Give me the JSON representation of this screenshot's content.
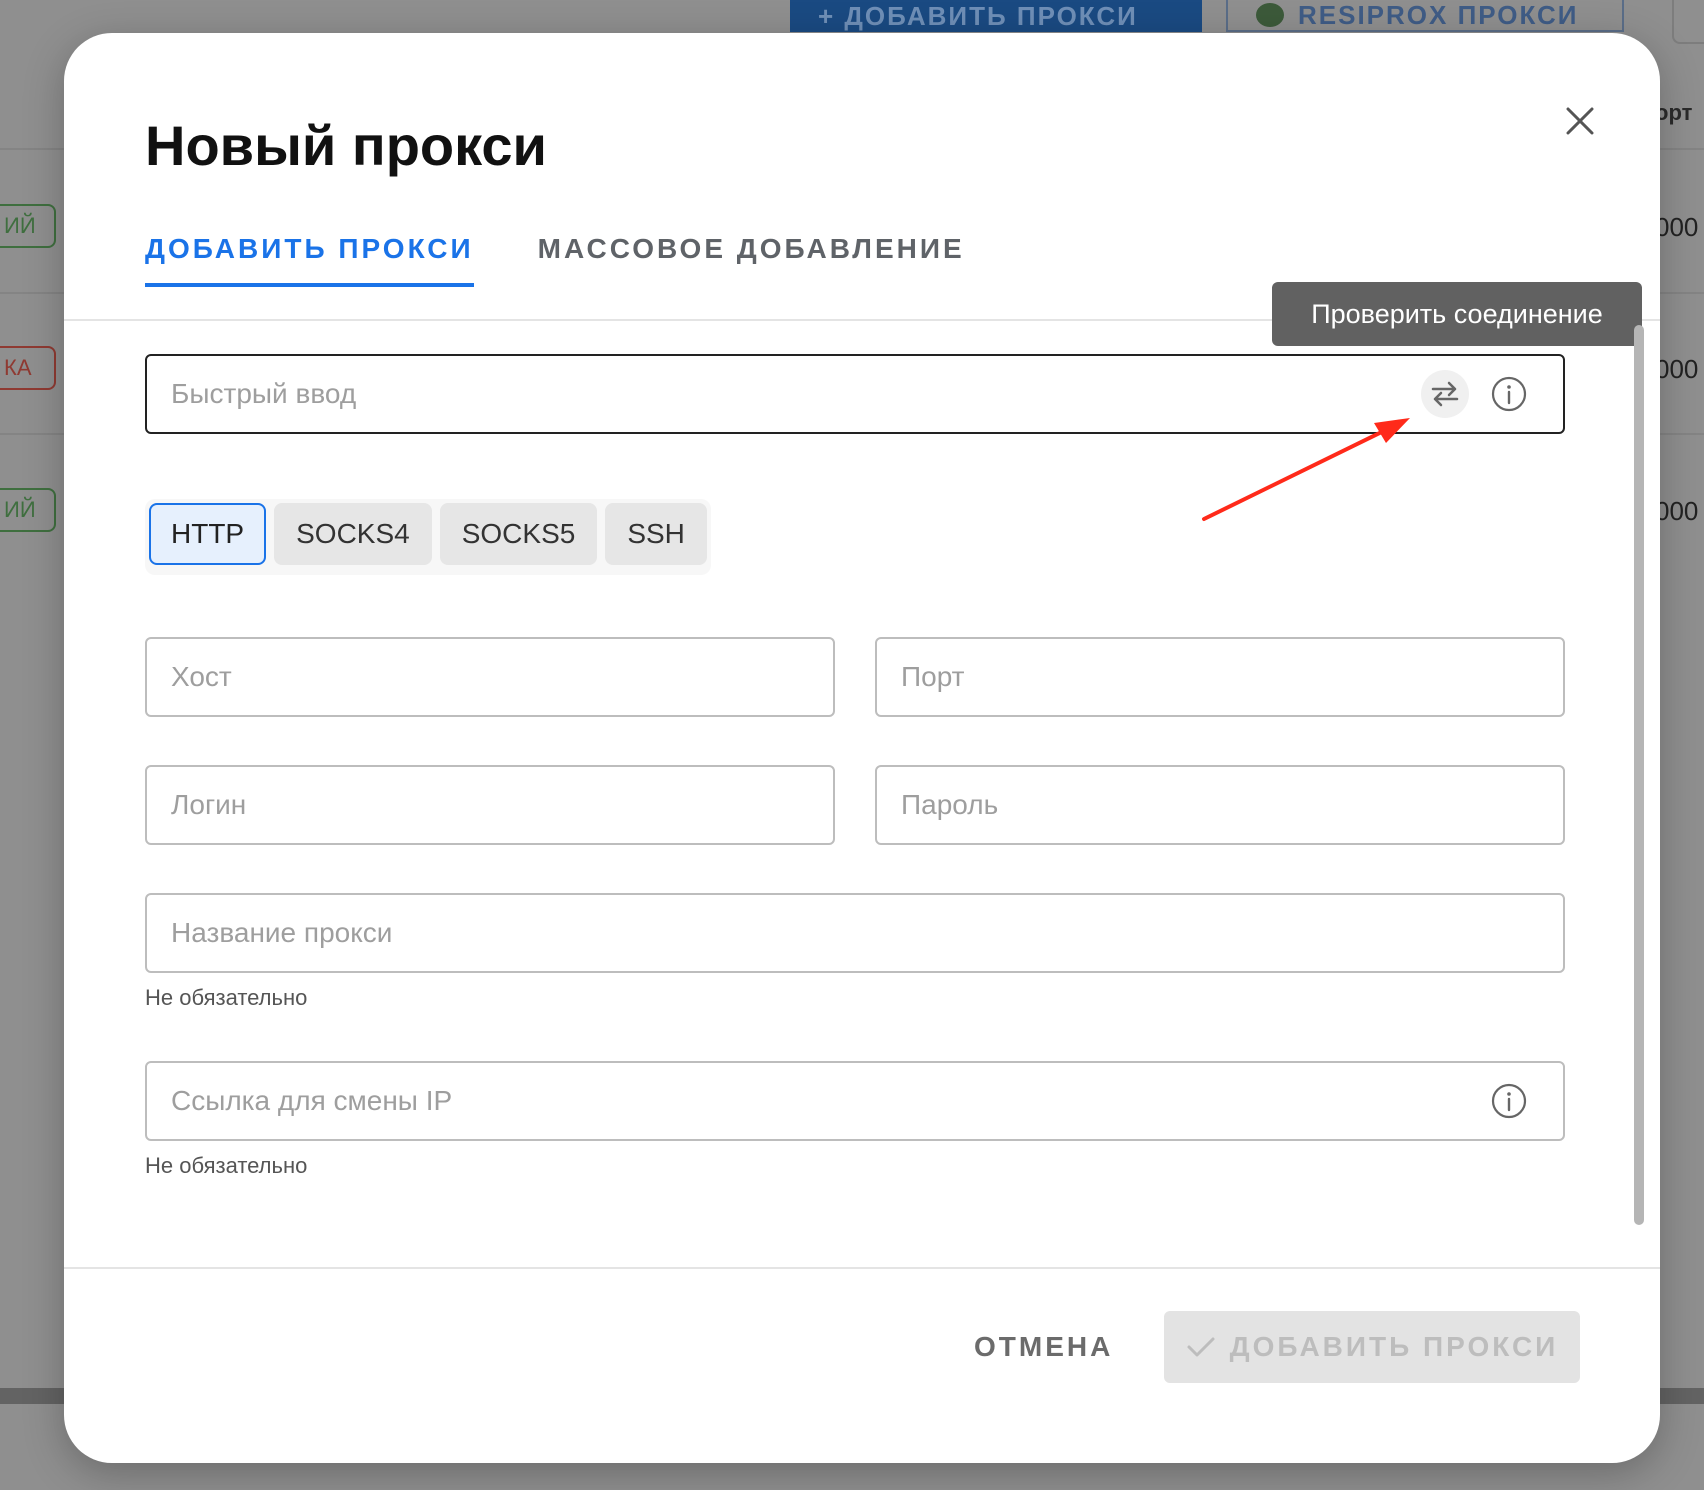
{
  "background": {
    "toolbar": {
      "add_proxy_label": "+ ДОБАВИТЬ ПРОКСИ",
      "resiprox_label": "RESIPROX ПРОКСИ"
    },
    "column_header": "орт",
    "rows": [
      {
        "status": "ИЙ",
        "status_color": "green",
        "port": "000"
      },
      {
        "status": "КА",
        "status_color": "red",
        "port": "000"
      },
      {
        "status": "ИЙ",
        "status_color": "green",
        "port": "000"
      }
    ]
  },
  "modal": {
    "title": "Новый прокси",
    "tabs": [
      {
        "label": "ДОБАВИТЬ ПРОКСИ",
        "active": true
      },
      {
        "label": "МАССОВОЕ ДОБАВЛЕНИЕ",
        "active": false
      }
    ],
    "tooltip": "Проверить соединение",
    "quick_input": {
      "placeholder": "Быстрый ввод",
      "value": ""
    },
    "proxy_types": [
      {
        "label": "HTTP",
        "selected": true
      },
      {
        "label": "SOCKS4",
        "selected": false
      },
      {
        "label": "SOCKS5",
        "selected": false
      },
      {
        "label": "SSH",
        "selected": false
      }
    ],
    "fields": {
      "host": {
        "placeholder": "Хост",
        "value": ""
      },
      "port": {
        "placeholder": "Порт",
        "value": ""
      },
      "login": {
        "placeholder": "Логин",
        "value": ""
      },
      "password": {
        "placeholder": "Пароль",
        "value": ""
      },
      "name": {
        "placeholder": "Название прокси",
        "value": "",
        "helper": "Не обязательно"
      },
      "ip_change_link": {
        "placeholder": "Ссылка для смены IP",
        "value": "",
        "helper": "Не обязательно"
      }
    },
    "footer": {
      "cancel_label": "ОТМЕНА",
      "submit_label": "ДОБАВИТЬ ПРОКСИ",
      "submit_enabled": false
    },
    "colors": {
      "accent": "#1a73e8",
      "annotation_arrow": "#ff2a1a"
    }
  }
}
